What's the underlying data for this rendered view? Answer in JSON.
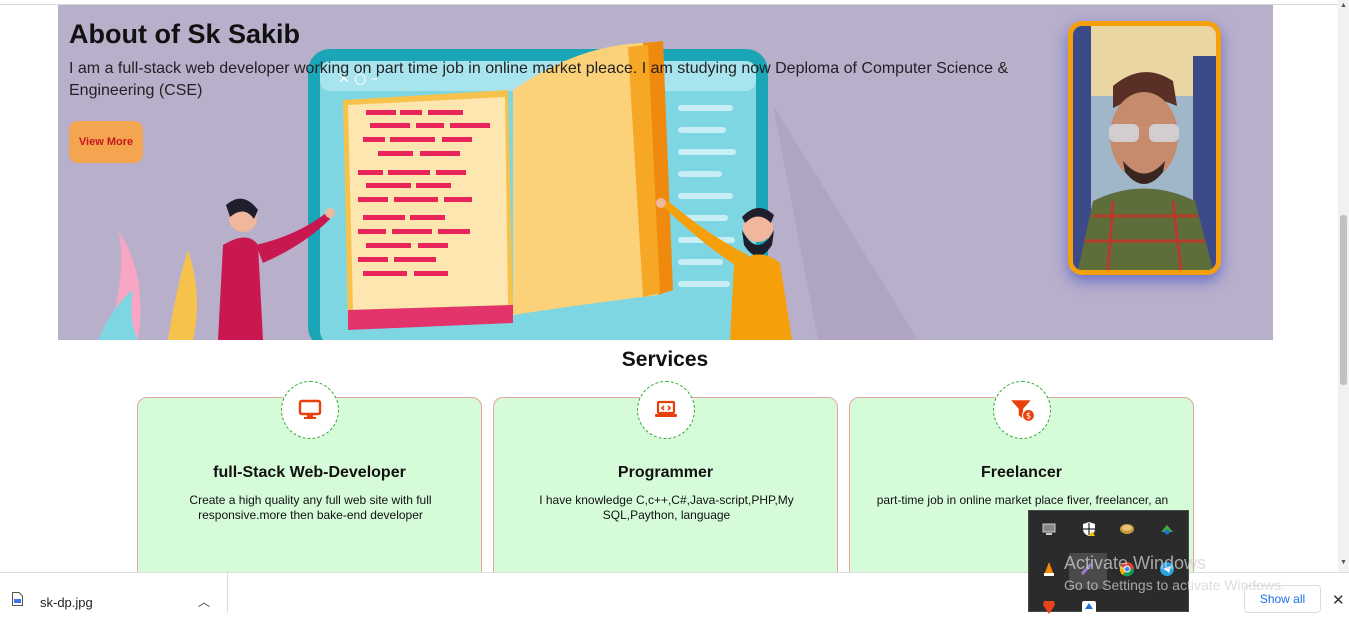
{
  "hero": {
    "title": "About of Sk Sakib",
    "description": "I am a full-stack web developer working on part time job in online market pleace. I am studying now Deploma of Computer Science & Engineering (CSE)",
    "button_label": "View More",
    "background_color": "#b8afcb",
    "frame_color": "#f5a00b"
  },
  "services": {
    "title": "Services",
    "cards": [
      {
        "icon": "monitor-icon",
        "title": "full-Stack Web-Developer",
        "text": "Create a high quality any full web site with full responsive.more then bake-end developer"
      },
      {
        "icon": "laptop-code-icon",
        "title": "Programmer",
        "text": "I have knowledge C,c++,C#,Java-script,PHP,My SQL,Paython, language"
      },
      {
        "icon": "funnel-dollar-icon",
        "title": "Freelancer",
        "text": "part-time job in online market place fiver, freelancer, an"
      }
    ],
    "card_bg": "#d5fbd9",
    "icon_color": "#e8400c"
  },
  "download_bar": {
    "file_name": "sk-dp.jpg",
    "show_all_label": "Show all"
  },
  "windows": {
    "watermark_title": "Activate Windows",
    "watermark_subtitle": "Go to Settings to activate Windows."
  }
}
